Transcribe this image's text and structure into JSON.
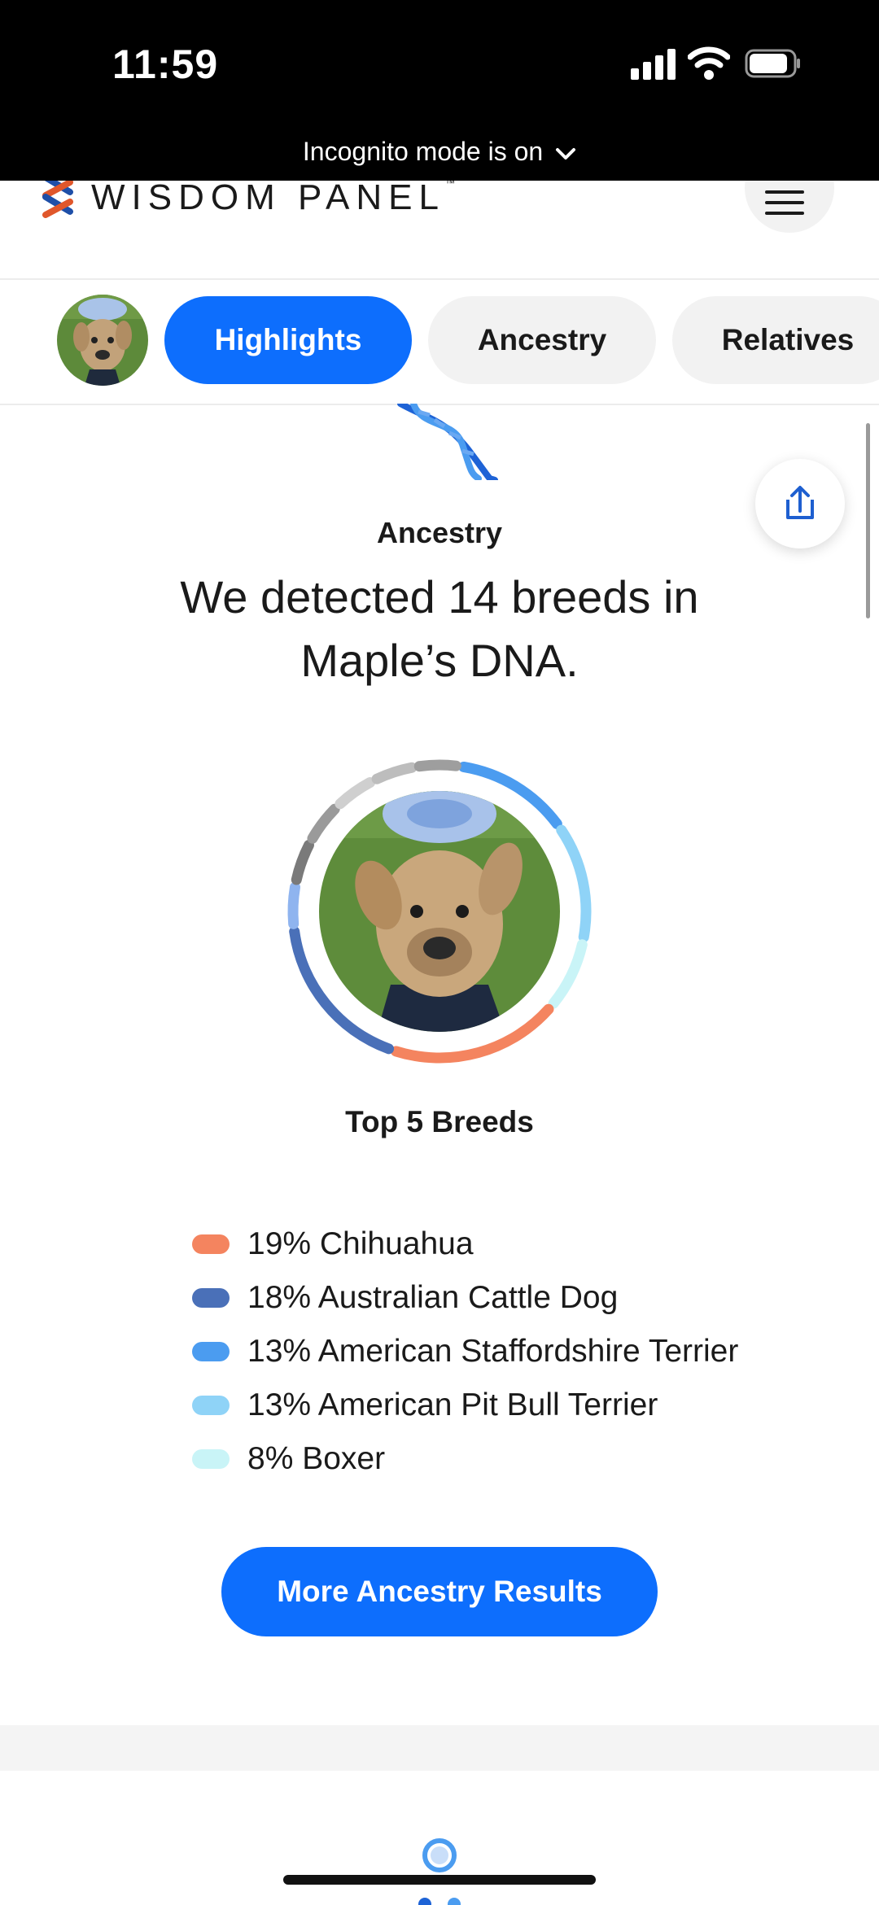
{
  "status_bar": {
    "time": "11:59",
    "incognito_text": "Incognito mode is on"
  },
  "header": {
    "logo_text": "WISDOM PANEL",
    "logo_trademark": "™",
    "menu_icon": "hamburger-menu-icon"
  },
  "tabs": [
    {
      "label": "Highlights",
      "active": true
    },
    {
      "label": "Ancestry",
      "active": false
    },
    {
      "label": "Relatives",
      "active": false
    }
  ],
  "section": {
    "icon": "dna-icon",
    "label": "Ancestry",
    "headline": "We detected 14 breeds in Maple’s DNA.",
    "share_icon": "share-icon"
  },
  "chart_data": {
    "type": "pie",
    "title": "Top 5 Breeds",
    "categories": [
      "Chihuahua",
      "Australian Cattle Dog",
      "American Staffordshire Terrier",
      "American Pit Bull Terrier",
      "Boxer"
    ],
    "values": [
      19,
      18,
      13,
      13,
      8
    ],
    "colors": [
      "#f4845f",
      "#4a70b8",
      "#4b9cf0",
      "#8fd3f7",
      "#c9f4f7"
    ]
  },
  "legend": [
    {
      "text": "19% Chihuahua",
      "color": "#f4845f"
    },
    {
      "text": "18% Australian Cattle Dog",
      "color": "#4a70b8"
    },
    {
      "text": "13% American Staffordshire Terrier",
      "color": "#4b9cf0"
    },
    {
      "text": "13% American Pit Bull Terrier",
      "color": "#8fd3f7"
    },
    {
      "text": "8% Boxer",
      "color": "#c9f4f7"
    }
  ],
  "cta": {
    "label": "More Ancestry Results"
  },
  "colors": {
    "primary": "#0d6efd",
    "status_bar": "#000000"
  }
}
